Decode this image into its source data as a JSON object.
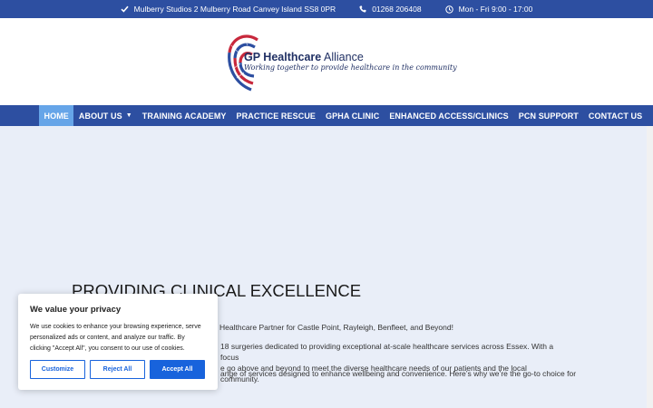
{
  "topbar": {
    "address": "Mulberry Studios 2 Mulberry Road Canvey Island SS8 0PR",
    "phone": "01268 206408",
    "hours": "Mon - Fri 9:00 - 17:00"
  },
  "logo": {
    "name_bold": "GP Healthcare",
    "name_rest": " Alliance",
    "tagline": "Working together to provide healthcare in the community"
  },
  "nav": {
    "items": [
      "HOME",
      "ABOUT US",
      "TRAINING ACADEMY",
      "PRACTICE RESCUE",
      "GPHA CLINIC",
      "ENHANCED ACCESS/CLINICS",
      "PCN SUPPORT",
      "CONTACT US"
    ],
    "active": "HOME"
  },
  "hero": {
    "headline": "PROVIDING CLINICAL EXCELLENCE",
    "p1": "Healthcare Partner for Castle Point, Rayleigh, Benfleet, and Beyond!",
    "p2a": "18 surgeries dedicated to providing exceptional at-scale healthcare services across Essex. With a focus",
    "p2b": "e go above and beyond to meet the diverse healthcare needs of our patients and the local community.",
    "p3": "ange of services designed to enhance wellbeing and convenience. Here’s why we’re the go-to choice for"
  },
  "cookie": {
    "title": "We value your privacy",
    "text": "We use cookies to enhance your browsing experience, serve personalized ads or content, and analyze our traffic. By clicking \"Accept All\", you consent to our use of cookies.",
    "customize": "Customize",
    "reject": "Reject All",
    "accept": "Accept All"
  },
  "colors": {
    "brand_blue": "#2d4fa1",
    "nav_active": "#66a5e8",
    "cookie_button": "#1863dc",
    "logo_red": "#c8283c"
  }
}
